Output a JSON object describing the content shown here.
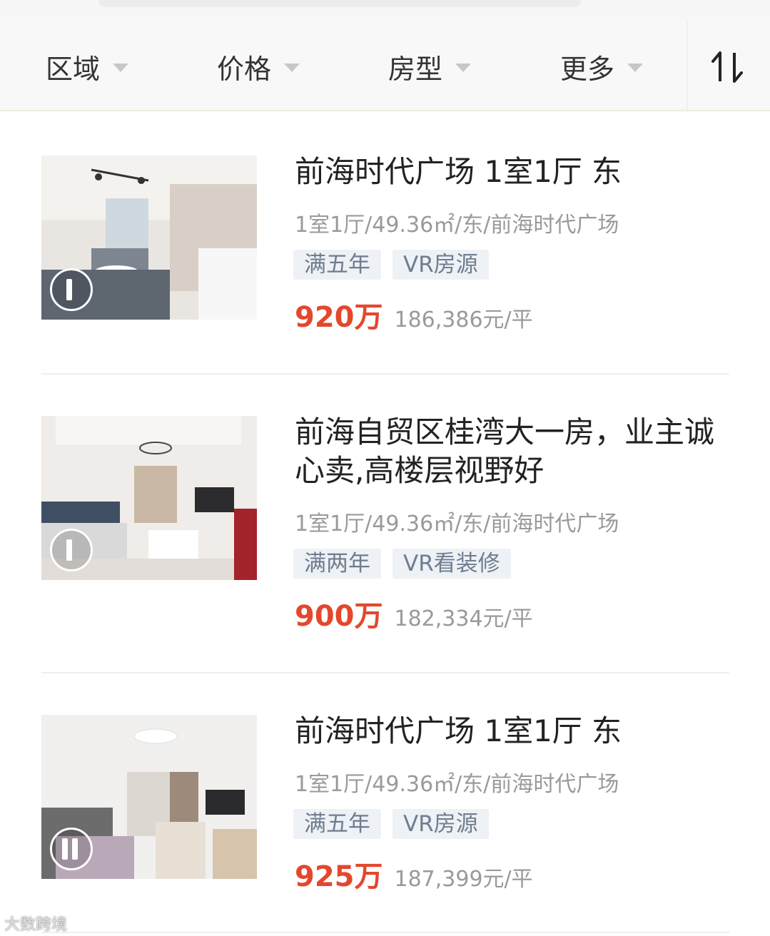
{
  "filters": [
    {
      "label": "区域"
    },
    {
      "label": "价格"
    },
    {
      "label": "房型"
    },
    {
      "label": "更多"
    }
  ],
  "sort": {
    "icon": "sort-icon"
  },
  "listings": [
    {
      "title": "前海时代广场 1室1厅 东",
      "meta": "1室1厅/49.36㎡/东/前海时代广场",
      "tags": [
        "满五年",
        "VR房源"
      ],
      "price": "920万",
      "unit_price": "186,386元/平",
      "thumb_icon": "vr-play-icon"
    },
    {
      "title": "前海自贸区桂湾大一房，业主诚心卖,高楼层视野好",
      "meta": "1室1厅/49.36㎡/东/前海时代广场",
      "tags": [
        "满两年",
        "VR看装修"
      ],
      "price": "900万",
      "unit_price": "182,334元/平",
      "thumb_icon": "vr-play-icon"
    },
    {
      "title": "前海时代广场 1室1厅 东",
      "meta": "1室1厅/49.36㎡/东/前海时代广场",
      "tags": [
        "满五年",
        "VR房源"
      ],
      "price": "925万",
      "unit_price": "187,399元/平",
      "thumb_icon": "vr-play-icon"
    }
  ],
  "watermark": "大数跨境",
  "colors": {
    "price": "#e4472d",
    "tag_bg": "#eef1f5",
    "tag_text": "#6f7d8f"
  }
}
